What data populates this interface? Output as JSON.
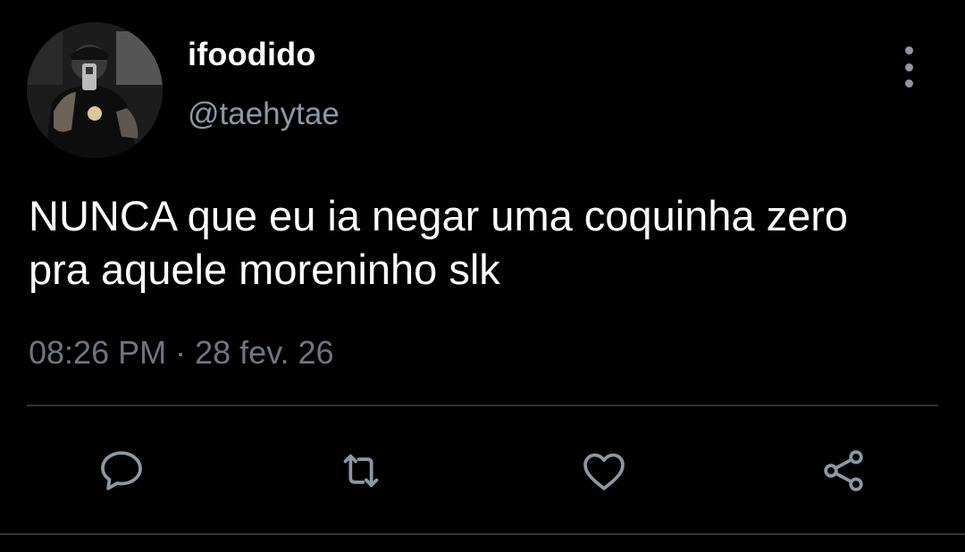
{
  "author": {
    "display_name": "ifoodido",
    "handle": "@taehytae"
  },
  "tweet": {
    "text": "NUNCA que eu ia negar uma coquinha zero\npra aquele moreninho slk",
    "time": "08:26 PM",
    "separator": "·",
    "date": "28 fev. 26"
  },
  "actions": {
    "reply_icon": "speech-bubble-icon",
    "retweet_icon": "retweet-arrows-icon",
    "like_icon": "heart-icon",
    "share_icon": "share-nodes-icon"
  },
  "colors": {
    "background": "#000000",
    "text": "#ffffff",
    "secondary": "#8b98a5",
    "muted": "#6e767d",
    "divider": "#2f3336"
  }
}
